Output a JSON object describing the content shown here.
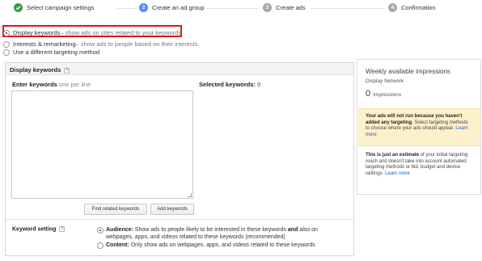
{
  "steps": [
    {
      "number": "",
      "label": "Select campaign settings",
      "state": "done"
    },
    {
      "number": "2",
      "label": "Create an ad group",
      "state": "active"
    },
    {
      "number": "3",
      "label": "Create ads",
      "state": "todo"
    },
    {
      "number": "4",
      "label": "Confirmation",
      "state": "todo"
    }
  ],
  "targeting_options": [
    {
      "title": "Display keywords",
      "description": " – show ads on sites related to your keywords.",
      "checked": true
    },
    {
      "title": "Interests & remarketing",
      "description": " – show ads to people based on their interests.",
      "checked": false
    },
    {
      "title": "Use a different targeting method",
      "description": "",
      "checked": false
    }
  ],
  "panel": {
    "title": "Display keywords",
    "help": "?",
    "enter_label": "Enter keywords",
    "enter_sub": "one per line",
    "selected_label": "Selected keywords:",
    "selected_count": "0",
    "textarea_value": "",
    "find_button": "Find related keywords",
    "add_button": "Add keywords",
    "setting_label": "Keyword setting",
    "audience_title": "Audience:",
    "audience_text_1": " Show ads to people likely to be interested in these keywords ",
    "audience_and": "and",
    "audience_text_2": " also on webpages, apps, and videos related to these keywords (recommended)",
    "content_title": "Content:",
    "content_text": " Only show ads on webpages, apps, and videos related to these keywords"
  },
  "card": {
    "title": "Weekly available impressions",
    "network": "Display Network",
    "impressions_value": "0",
    "impressions_label": "Impressions",
    "warning_bold": "Your ads will not run because you haven't added any targeting.",
    "warning_text": " Select targeting methods to choose where your ads should appear. ",
    "warning_link": "Learn more",
    "note_bold": "This is just an estimate",
    "note_text": " of your initial targeting reach and doesn't take into account automated targeting methods or bid, budget and device settings. ",
    "note_link": "Learn more"
  },
  "colors": {
    "done": "#3a9c3a",
    "active": "#4d90fe",
    "todo": "#a8a8a8",
    "highlight": "#d9171f",
    "warning_bg": "#fdf1cb",
    "link": "#1a5dc8"
  }
}
